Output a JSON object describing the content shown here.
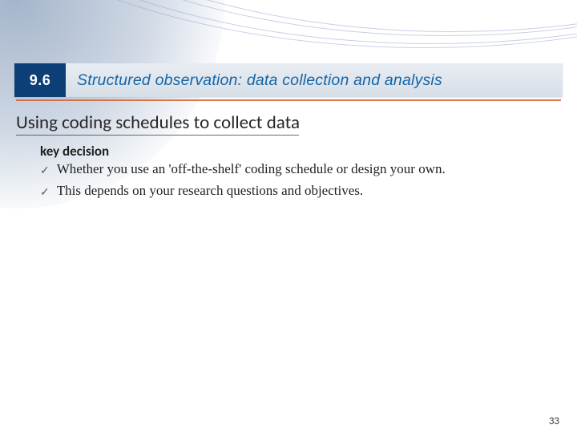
{
  "section": {
    "number": "9.6",
    "title": "Structured observation: data collection and analysis"
  },
  "heading": "Using coding schedules to collect data",
  "subhead": "key decision",
  "bullets": [
    "Whether you use an 'off-the-shelf' coding schedule or design your own.",
    "This depends on your research questions and objectives."
  ],
  "page_number": "33"
}
